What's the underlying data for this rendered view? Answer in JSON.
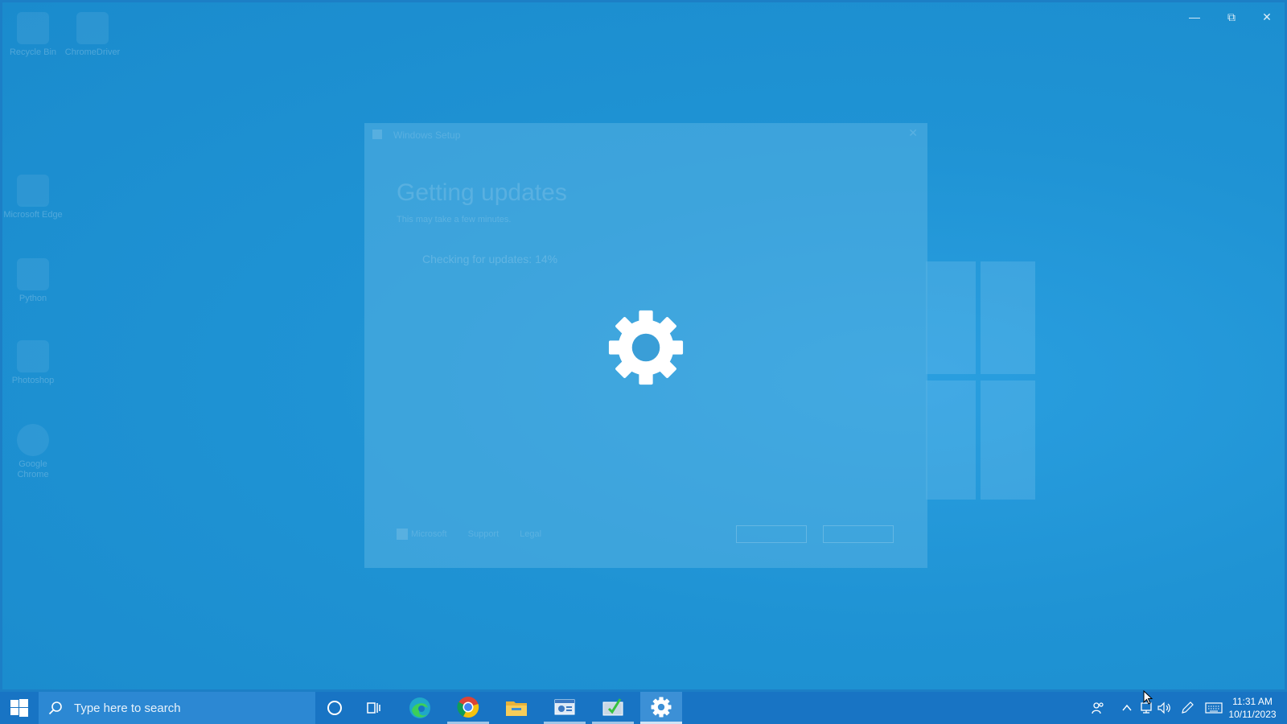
{
  "window_controls": {
    "minimize": "—",
    "restore": "⧉",
    "close": "✕"
  },
  "desktop": {
    "icons": [
      {
        "label": "Recycle Bin",
        "icon": "recycle-bin-icon"
      },
      {
        "label": "ChromeDriver",
        "icon": "file-icon"
      },
      {
        "label": "Microsoft Edge",
        "icon": "edge-icon"
      },
      {
        "label": "Python",
        "icon": "python-icon"
      },
      {
        "label": "Photoshop",
        "icon": "app-icon"
      },
      {
        "label": "Google Chrome",
        "icon": "chrome-icon"
      }
    ]
  },
  "setup_dialog": {
    "title": "Windows Setup",
    "heading": "Getting updates",
    "subtitle": "This may take a few minutes.",
    "status": "Checking for updates: 14%",
    "progress_percent": 14,
    "footer": {
      "brand": "Microsoft",
      "support": "Support",
      "legal": "Legal"
    },
    "close_glyph": "✕"
  },
  "overlay": {
    "spinner_icon": "gear-icon",
    "spinner_color": "#ffffff"
  },
  "taskbar": {
    "search_placeholder": "Type here to search",
    "apps": [
      {
        "name": "cortana",
        "icon": "circle-icon"
      },
      {
        "name": "task-view",
        "icon": "task-view-icon"
      },
      {
        "name": "edge",
        "icon": "edge-icon"
      },
      {
        "name": "chrome",
        "icon": "chrome-icon",
        "active": true
      },
      {
        "name": "file-explorer",
        "icon": "folder-icon"
      },
      {
        "name": "control-panel",
        "icon": "control-panel-icon",
        "active": true
      },
      {
        "name": "installer",
        "icon": "installer-icon",
        "active": true
      },
      {
        "name": "settings",
        "icon": "gear-icon",
        "current": true
      }
    ],
    "clock": {
      "time": "11:31 AM",
      "date": "10/11/2023"
    }
  },
  "colors": {
    "desktop_bg": "#2095d6",
    "taskbar_bg": "#1874c4",
    "search_bg": "#2c88d3"
  }
}
